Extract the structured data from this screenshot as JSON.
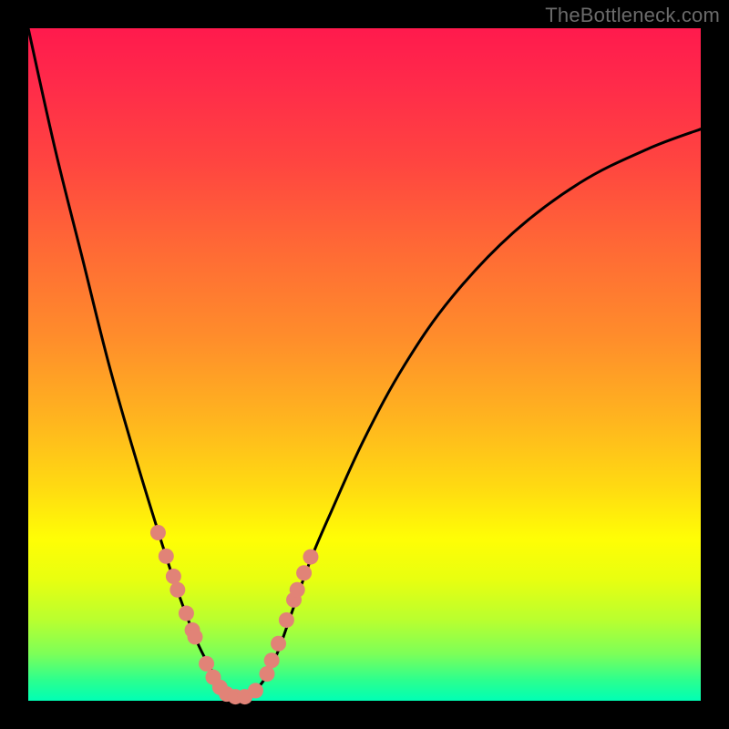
{
  "watermark": "TheBottleneck.com",
  "chart_data": {
    "type": "line",
    "title": "",
    "xlabel": "",
    "ylabel": "",
    "xlim": [
      0,
      1
    ],
    "ylim": [
      0,
      1
    ],
    "series": [
      {
        "name": "curve",
        "x": [
          0.0,
          0.04,
          0.08,
          0.12,
          0.16,
          0.2,
          0.225,
          0.25,
          0.27,
          0.285,
          0.3,
          0.315,
          0.33,
          0.35,
          0.37,
          0.395,
          0.42,
          0.45,
          0.5,
          0.56,
          0.63,
          0.72,
          0.82,
          0.92,
          1.0
        ],
        "y": [
          1.0,
          0.82,
          0.66,
          0.5,
          0.36,
          0.23,
          0.155,
          0.09,
          0.05,
          0.025,
          0.01,
          0.005,
          0.01,
          0.03,
          0.07,
          0.14,
          0.21,
          0.28,
          0.39,
          0.5,
          0.6,
          0.695,
          0.77,
          0.82,
          0.85
        ]
      }
    ],
    "markers": {
      "name": "highlighted-points",
      "x": [
        0.193,
        0.205,
        0.216,
        0.222,
        0.235,
        0.244,
        0.248,
        0.265,
        0.275,
        0.285,
        0.295,
        0.308,
        0.322,
        0.338,
        0.355,
        0.362,
        0.372,
        0.384,
        0.395,
        0.4,
        0.41,
        0.42
      ],
      "y": [
        0.25,
        0.215,
        0.185,
        0.165,
        0.13,
        0.105,
        0.095,
        0.055,
        0.035,
        0.02,
        0.01,
        0.006,
        0.006,
        0.015,
        0.04,
        0.06,
        0.085,
        0.12,
        0.15,
        0.165,
        0.19,
        0.214
      ]
    },
    "background_gradient": {
      "orientation": "vertical",
      "stops": [
        {
          "pos": 0.0,
          "color": "#ff1a4d"
        },
        {
          "pos": 0.5,
          "color": "#ffae22"
        },
        {
          "pos": 0.78,
          "color": "#fffe05"
        },
        {
          "pos": 1.0,
          "color": "#00ffb5"
        }
      ]
    }
  }
}
